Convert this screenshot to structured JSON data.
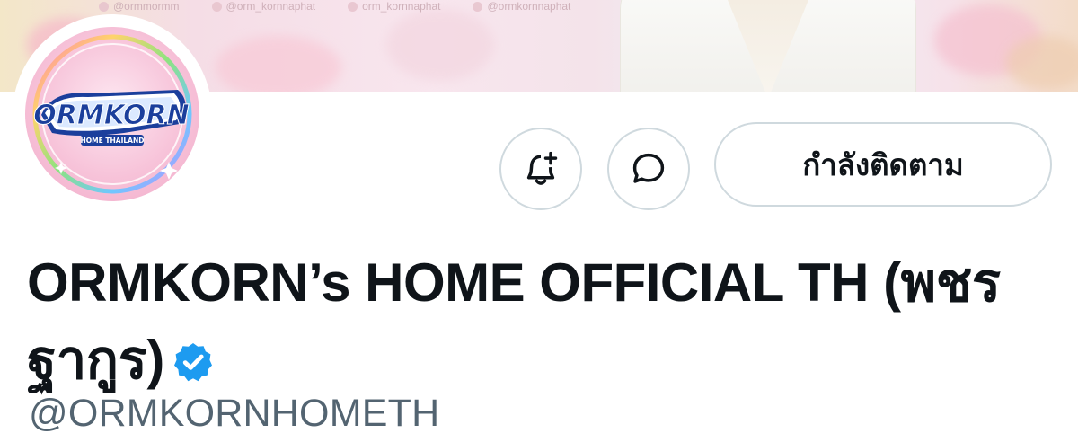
{
  "banner": {
    "social_handles": [
      "@ormmormm",
      "@orm_kornnaphat",
      "orm_kornnaphat",
      "@ormkornnaphat"
    ]
  },
  "avatar": {
    "logo_text": "ORMKORN",
    "logo_subtext": "HOME THAILAND"
  },
  "actions": {
    "follow_label": "กำลังติดตาม"
  },
  "profile": {
    "display_name": "ORMKORN’s HOME OFFICIAL TH (พชรฐากูร)",
    "handle": "@ORMKORNHOMETH",
    "verified": true
  },
  "colors": {
    "verified_blue": "#1d9bf0",
    "border": "#cfd9de",
    "handle_gray": "#536471",
    "text": "#0f1419"
  },
  "icons": [
    "notification-bell-plus-icon",
    "message-bubble-icon",
    "verified-badge-icon"
  ]
}
